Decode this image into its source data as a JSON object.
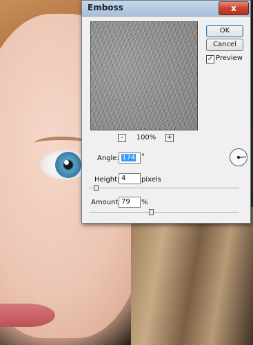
{
  "dialog": {
    "title": "Emboss",
    "close_label": "x",
    "ok_label": "OK",
    "cancel_label": "Cancel",
    "preview_checkbox_checked": true,
    "preview_label": "Preview",
    "zoom_minus": "-",
    "zoom_level": "100%",
    "zoom_plus": "+",
    "angle": {
      "label": "Angle:",
      "value": "174",
      "unit": "°"
    },
    "height": {
      "label": "Height:",
      "value": "4",
      "unit": "pixels",
      "slider_fraction": 0.03
    },
    "amount": {
      "label": "Amount:",
      "value": "79",
      "unit": "%",
      "slider_fraction": 0.4
    }
  },
  "colors": {
    "titlebar": "#a8c0d8",
    "close_button": "#c9452f",
    "selection": "#3399ff",
    "dialog_bg": "#f0f0f0"
  },
  "icons": [
    "close-icon",
    "checkmark-icon",
    "zoom-minus-icon",
    "zoom-plus-icon",
    "angle-dial-icon"
  ]
}
